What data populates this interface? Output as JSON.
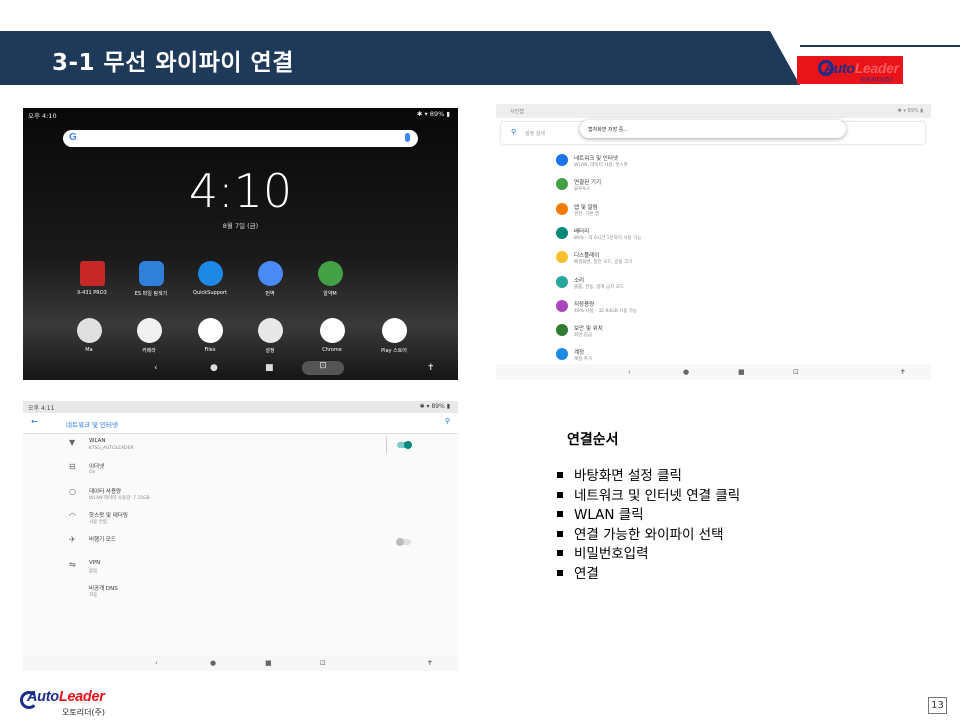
{
  "slide": {
    "title": "3-1 무선 와이파이 연결",
    "page_number": "13",
    "banner_color": "#1f3a59"
  },
  "logo": {
    "brand_main": "Auto",
    "brand_accent": "Leader",
    "sub_label": "오토리더(주)",
    "corner_bg": "#e8141a",
    "brand_color": "#1b2d8a"
  },
  "home_screen": {
    "status_left": "오후 4:10",
    "status_right": "89%",
    "google_letter": "G",
    "clock": "4:10",
    "date": "8월 7일 (금)",
    "apps_row1": [
      {
        "label": "X-431 PRO3",
        "icon": "x431-icon",
        "color": "#c62828"
      },
      {
        "label": "ES 파일 탐색기",
        "icon": "es-file-icon",
        "color": "#2f80d8"
      },
      {
        "label": "QuickSupport",
        "icon": "quicksupport-icon",
        "color": "#1e88e5"
      },
      {
        "label": "번역",
        "icon": "translate-icon",
        "color": "#4a8af4"
      },
      {
        "label": "알약M",
        "icon": "pill-icon",
        "color": "#43a047"
      }
    ],
    "apps_row2": [
      {
        "label": "Ma",
        "icon": "maps-icon",
        "color": "#e0e0e0"
      },
      {
        "label": "카메라",
        "icon": "camera-icon",
        "color": "#f1f1f1"
      },
      {
        "label": "Files",
        "icon": "files-icon",
        "color": "#ffffff"
      },
      {
        "label": "설정",
        "icon": "settings-gear-icon",
        "color": "#e8e8e8"
      },
      {
        "label": "Chrome",
        "icon": "chrome-icon",
        "color": "#ffffff"
      },
      {
        "label": "Play 스토어",
        "icon": "play-store-icon",
        "color": "#ffffff"
      }
    ]
  },
  "settings_screen": {
    "status_left": "사진캡",
    "status_right": "89%",
    "search_placeholder": "설정 검색",
    "toast": "캡처화면 저장 중...",
    "items": [
      {
        "title": "네트워크 및 인터넷",
        "subtitle": "WLAN, 데이터 사용, 핫스팟",
        "color": "#1a73e8",
        "icon": "wifi-icon"
      },
      {
        "title": "연결된 기기",
        "subtitle": "블루투스",
        "color": "#43a047",
        "icon": "devices-icon"
      },
      {
        "title": "앱 및 알림",
        "subtitle": "권한, 기본 앱",
        "color": "#f57c00",
        "icon": "apps-icon"
      },
      {
        "title": "배터리",
        "subtitle": "89% - 약 6시간 1분까지 사용 가능",
        "color": "#00897b",
        "icon": "battery-icon"
      },
      {
        "title": "디스플레이",
        "subtitle": "배경화면, 절전 모드, 글꼴 크기",
        "color": "#fbc02d",
        "icon": "display-icon"
      },
      {
        "title": "소리",
        "subtitle": "볼륨, 진동, 방해 금지 모드",
        "color": "#26a69a",
        "icon": "sound-icon"
      },
      {
        "title": "저장용량",
        "subtitle": "49% 사용 - 32.94GB 사용 가능",
        "color": "#ab47bc",
        "icon": "storage-icon"
      },
      {
        "title": "보안 및 위치",
        "subtitle": "화면 잠금",
        "color": "#2e7d32",
        "icon": "lock-icon"
      },
      {
        "title": "계정",
        "subtitle": "계정 추가",
        "color": "#1e88e5",
        "icon": "account-icon"
      }
    ]
  },
  "network_screen": {
    "status_left": "오후 4:11",
    "status_right": "89%",
    "header_title": "네트워크 및 인터넷",
    "items": [
      {
        "title": "WLAN",
        "subtitle": "KT5G_AUTOLEADER",
        "icon": "wifi-icon",
        "toggle": true
      },
      {
        "title": "이더넷",
        "subtitle": "On",
        "icon": "ethernet-icon",
        "toggle": null
      },
      {
        "title": "데이터 사용량",
        "subtitle": "WLAN 데이터 사용량: 7.15GB",
        "icon": "data-usage-icon",
        "toggle": null
      },
      {
        "title": "핫스팟 및 테더링",
        "subtitle": "사용 안함",
        "icon": "hotspot-icon",
        "toggle": null
      },
      {
        "title": "비행기 모드",
        "subtitle": "",
        "icon": "airplane-icon",
        "toggle": false
      },
      {
        "title": "VPN",
        "subtitle": "없음",
        "icon": "vpn-icon",
        "toggle": null
      },
      {
        "title": "비공개 DNS",
        "subtitle": "자동",
        "icon": "",
        "toggle": null
      }
    ],
    "toggle_on_color": "#00897b",
    "toggle_off_color": "#bdbdbd"
  },
  "instructions": {
    "title": "연결순서",
    "steps": [
      "바탕화면 설정 클릭",
      "네트워크 및 인터넷 연결 클릭",
      "WLAN 클릭",
      "연결 가능한 와이파이 선택",
      "비밀번호입력",
      "연결"
    ]
  }
}
